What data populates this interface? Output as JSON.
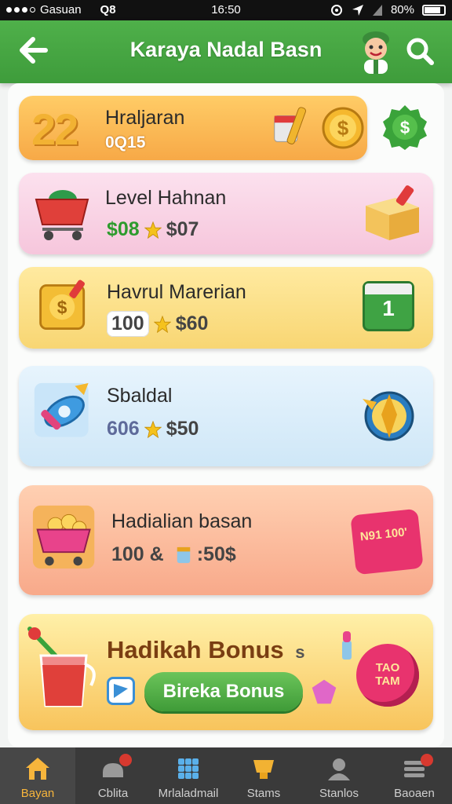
{
  "status_bar": {
    "carrier": "Gasuan",
    "network": "Q8",
    "time": "16:50",
    "battery": "80%"
  },
  "app_bar": {
    "title": "Karaya Nadal Basn"
  },
  "cards": [
    {
      "title": "Hraljaran",
      "stat": "0Q15",
      "big": "22"
    },
    {
      "title": "Level Hahnan",
      "stat_a": "$08",
      "stat_b": "$07"
    },
    {
      "title": "Havrul Marerian",
      "stat_a": "100",
      "stat_b": "$60",
      "calendar": "1"
    },
    {
      "title": "Sbaldal",
      "stat_a": "606",
      "stat_b": "$50"
    },
    {
      "title": "Hadialian basan",
      "stat_a": "100 &",
      "stat_b": ":50$",
      "tag": "N91 100'"
    },
    {
      "title": "Hadikah Bonus",
      "suffix": "s",
      "button": "Bireka Bonus",
      "tag": "TAO TAM"
    }
  ],
  "bottom_nav": [
    {
      "label": "Bayan",
      "icon": "home-icon",
      "active": true
    },
    {
      "label": "Cblita",
      "icon": "game-icon",
      "badge": true
    },
    {
      "label": "Mrlaladmail",
      "icon": "grid-icon"
    },
    {
      "label": "Stams",
      "icon": "trophy-icon"
    },
    {
      "label": "Stanlos",
      "icon": "profile-icon"
    },
    {
      "label": "Baoaen",
      "icon": "menu-icon",
      "badge": true
    }
  ],
  "colors": {
    "accent": "#3e9c3b",
    "nav_active": "#f7b53c",
    "nav_bg": "#3a3a3a"
  }
}
